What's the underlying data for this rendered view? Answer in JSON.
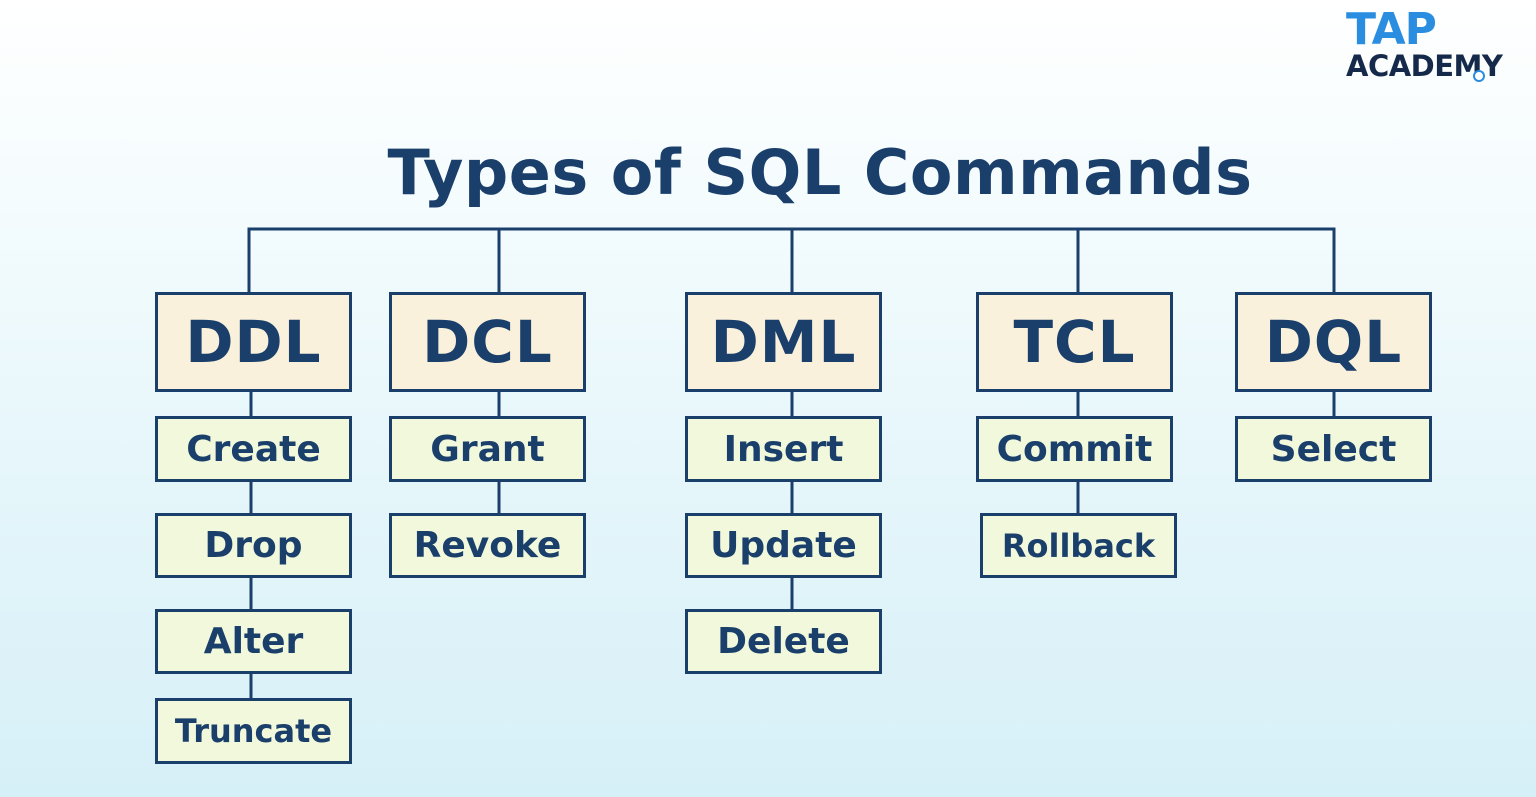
{
  "title": "Types of SQL Commands",
  "logo": {
    "line1": "TAP",
    "line2": "ACADEMY"
  },
  "categories": [
    {
      "name": "DDL",
      "commands": [
        "Create",
        "Drop",
        "Alter",
        "Truncate"
      ]
    },
    {
      "name": "DCL",
      "commands": [
        "Grant",
        "Revoke"
      ]
    },
    {
      "name": "DML",
      "commands": [
        "Insert",
        "Update",
        "Delete"
      ]
    },
    {
      "name": "TCL",
      "commands": [
        "Commit",
        "Rollback"
      ]
    },
    {
      "name": "DQL",
      "commands": [
        "Select"
      ]
    }
  ],
  "colors": {
    "line": "#1b3f6b",
    "category_fill": "#faf1dc",
    "command_fill": "#f1f8dc",
    "logo_accent": "#2b8de0",
    "logo_dark": "#15294a"
  }
}
